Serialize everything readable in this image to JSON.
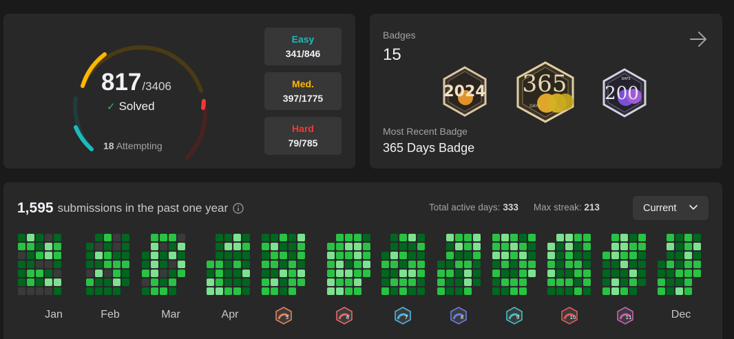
{
  "progress": {
    "solved": "817",
    "total": "/3406",
    "solved_label": "Solved",
    "attempting_count": "18",
    "attempting_label": "Attempting",
    "difficulties": [
      {
        "name": "Easy",
        "value": "341/846",
        "color": "#1cbaba",
        "solved": 341,
        "total": 846
      },
      {
        "name": "Med.",
        "value": "397/1775",
        "color": "#ffb700",
        "solved": 397,
        "total": 1775
      },
      {
        "name": "Hard",
        "value": "79/785",
        "color": "#f63737",
        "solved": 79,
        "total": 785
      }
    ]
  },
  "badges": {
    "label": "Badges",
    "count": "15",
    "items": [
      {
        "icon": "badge-2024-icon",
        "text": "2024"
      },
      {
        "icon": "badge-365-days-icon",
        "text": "365",
        "sub": "DAYS"
      },
      {
        "icon": "badge-200-days-icon",
        "text": "200",
        "sub": "DAYS"
      }
    ],
    "recent_label": "Most Recent Badge",
    "recent_name": "365 Days Badge"
  },
  "calendar": {
    "count": "1,595",
    "text": "submissions in the past one year",
    "active_days_label": "Total active days:",
    "active_days": "333",
    "max_streak_label": "Max streak:",
    "max_streak": "213",
    "dropdown": "Current",
    "months": [
      {
        "label": "Jan"
      },
      {
        "label": "Feb"
      },
      {
        "label": "Mar"
      },
      {
        "label": "Apr"
      },
      {
        "label": "",
        "badge": "5",
        "color": "#e9825d"
      },
      {
        "label": "",
        "badge": "6",
        "color": "#e46a6a"
      },
      {
        "label": "",
        "badge": "7",
        "color": "#4db8e6"
      },
      {
        "label": "",
        "badge": "8",
        "color": "#6a7fe6"
      },
      {
        "label": "",
        "badge": "9",
        "color": "#42c1c8"
      },
      {
        "label": "",
        "badge": "10",
        "color": "#e65a5a"
      },
      {
        "label": "",
        "badge": "11",
        "color": "#d160b5"
      },
      {
        "label": "Dec"
      }
    ],
    "colors": {
      "empty": "#3a3a3a",
      "level1": "#016620",
      "level2": "#28c244",
      "level3": "#7ee191"
    }
  }
}
